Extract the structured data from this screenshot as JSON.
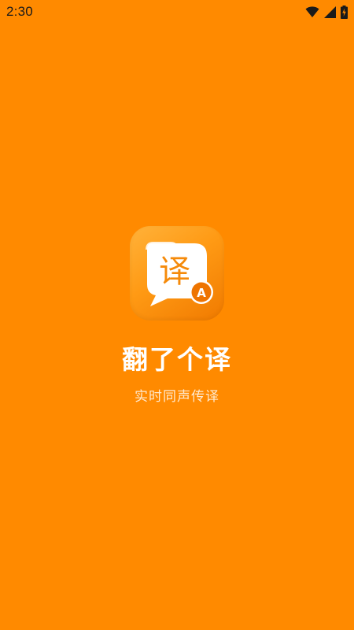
{
  "status_bar": {
    "time": "2:30",
    "icons": [
      "wifi-icon",
      "cell-signal-icon",
      "battery-icon"
    ]
  },
  "splash": {
    "icon_glyph": "译",
    "icon_badge": "A",
    "app_name": "翻了个译",
    "slogan": "实时同声传译"
  },
  "colors": {
    "background": "#FF8A00",
    "icon_gradient_light": "#FFB23A",
    "icon_gradient_dark": "#F07A00",
    "text_primary": "#FFFFFF",
    "text_secondary": "#FFE9CF"
  }
}
